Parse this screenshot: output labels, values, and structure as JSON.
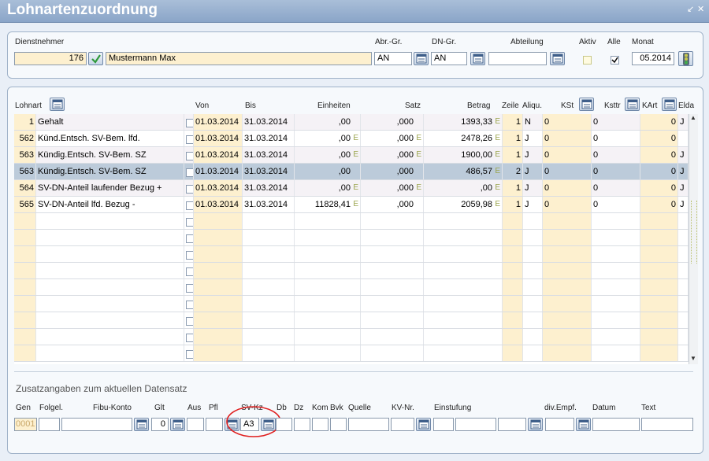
{
  "window": {
    "title": "Lohnartenzuordnung",
    "controls": "↙ ✕"
  },
  "header": {
    "dienstnehmer_label": "Dienstnehmer",
    "dn_nr": "176",
    "dn_name": "Mustermann Max",
    "abr_gr_label": "Abr.-Gr.",
    "abr_gr": "AN",
    "dn_gr_label": "DN-Gr.",
    "dn_gr": "AN",
    "abteilung_label": "Abteilung",
    "abteilung": "",
    "aktiv_label": "Aktiv",
    "aktiv": false,
    "alle_label": "Alle",
    "alle": true,
    "monat_label": "Monat",
    "monat": "05.2014"
  },
  "columns": {
    "lohnart": "Lohnart",
    "von": "Von",
    "bis": "Bis",
    "einheiten": "Einheiten",
    "satz": "Satz",
    "betrag": "Betrag",
    "zeile": "Zeile",
    "aliqu": "Aliqu.",
    "kst": "KSt",
    "ksttr": "Ksttr",
    "kart": "KArt",
    "elda": "Elda"
  },
  "rows": [
    {
      "nr": "1",
      "text": "Gehalt",
      "von": "01.03.2014",
      "bis": "31.03.2014",
      "einheiten": ",00",
      "einh_e": "",
      "satz": ",000",
      "satz_e": "",
      "betrag": "1393,33",
      "betrag_e": "E",
      "zeile": "1",
      "aliqu": "N",
      "kst": "0",
      "ksttr": "0",
      "kart": "0",
      "elda": "J",
      "selected": false
    },
    {
      "nr": "562",
      "text": "Künd.Entsch. SV-Bem. lfd.",
      "von": "01.03.2014",
      "bis": "31.03.2014",
      "einheiten": ",00",
      "einh_e": "E",
      "satz": ",000",
      "satz_e": "E",
      "betrag": "2478,26",
      "betrag_e": "E",
      "zeile": "1",
      "aliqu": "J",
      "kst": "0",
      "ksttr": "0",
      "kart": "0",
      "elda": "",
      "selected": false
    },
    {
      "nr": "563",
      "text": "Kündig.Entsch. SV-Bem. SZ",
      "von": "01.03.2014",
      "bis": "31.03.2014",
      "einheiten": ",00",
      "einh_e": "E",
      "satz": ",000",
      "satz_e": "E",
      "betrag": "1900,00",
      "betrag_e": "E",
      "zeile": "1",
      "aliqu": "J",
      "kst": "0",
      "ksttr": "0",
      "kart": "0",
      "elda": "J",
      "selected": false
    },
    {
      "nr": "563",
      "text": "Kündig.Entsch. SV-Bem. SZ",
      "von": "01.03.2014",
      "bis": "31.03.2014",
      "einheiten": ",00",
      "einh_e": "",
      "satz": ",000",
      "satz_e": "",
      "betrag": "486,57",
      "betrag_e": "E",
      "zeile": "2",
      "aliqu": "J",
      "kst": "0",
      "ksttr": "0",
      "kart": "0",
      "elda": "J",
      "selected": true
    },
    {
      "nr": "564",
      "text": "SV-DN-Anteil laufender Bezug +",
      "von": "01.03.2014",
      "bis": "31.03.2014",
      "einheiten": ",00",
      "einh_e": "E",
      "satz": ",000",
      "satz_e": "E",
      "betrag": ",00",
      "betrag_e": "E",
      "zeile": "1",
      "aliqu": "J",
      "kst": "0",
      "ksttr": "0",
      "kart": "0",
      "elda": "J",
      "selected": false
    },
    {
      "nr": "565",
      "text": "SV-DN-Anteil lfd. Bezug -",
      "von": "01.03.2014",
      "bis": "31.03.2014",
      "einheiten": "11828,41",
      "einh_e": "E",
      "satz": ",000",
      "satz_e": "",
      "betrag": "2059,98",
      "betrag_e": "E",
      "zeile": "1",
      "aliqu": "J",
      "kst": "0",
      "ksttr": "0",
      "kart": "0",
      "elda": "J",
      "selected": false
    }
  ],
  "empty_rows": 9,
  "footer": {
    "title": "Zusatzangaben zum aktuellen Datensatz",
    "gen_label": "Gen",
    "gen": "0001",
    "folgel_label": "Folgel.",
    "fibu_label": "Fibu-Konto",
    "glt_label": "Glt",
    "glt": "0",
    "aus_label": "Aus",
    "pfl_label": "Pfl",
    "svkz_label": "SV-Kz",
    "svkz": "A3",
    "db_label": "Db",
    "dz_label": "Dz",
    "kom_label": "Kom",
    "bvk_label": "Bvk",
    "quelle_label": "Quelle",
    "kvnr_label": "KV-Nr.",
    "einstufung_label": "Einstufung",
    "divempf_label": "div.Empf.",
    "datum_label": "Datum",
    "text_label": "Text"
  },
  "colors": {
    "accent": "#8aa5c8",
    "yellow_cell": "#fdf0cf",
    "selected_row": "#bccbda",
    "highlight_circle": "#e02020"
  }
}
